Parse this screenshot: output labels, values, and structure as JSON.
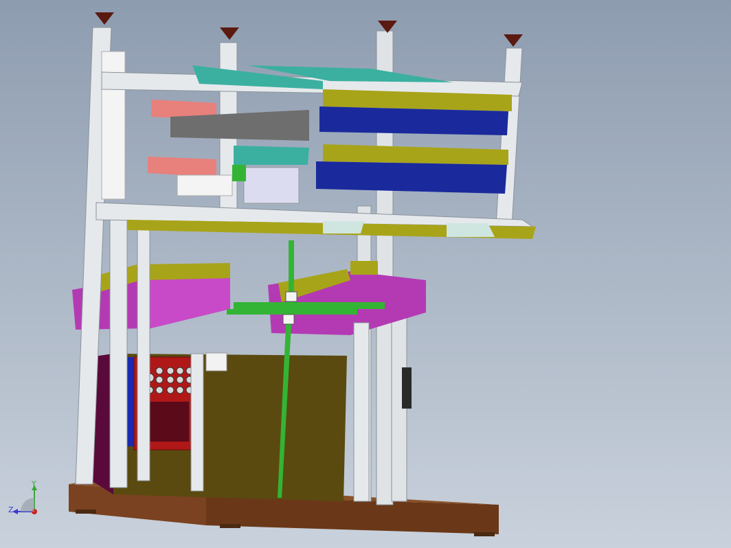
{
  "view": {
    "background_top": "#8e9cb0",
    "background_bottom": "#c9d1dc"
  },
  "triad": {
    "y_label": "Y",
    "z_label": "Z",
    "y_color": "#3aa63a",
    "z_color": "#3a3ad0",
    "x_color": "#d02020"
  },
  "colors": {
    "frame": "#dfe3e6",
    "frame_shadow": "#9aa3aa",
    "tray_olive": "#a8a419",
    "tray_blue": "#1a2a9c",
    "tray_teal": "#3cb0a0",
    "pink": "#e8807c",
    "dark_grey": "#6e6e6e",
    "magenta": "#b43ab4",
    "cylinder_green": "#34b434",
    "base_brown": "#6e3a18",
    "cabinet_olive": "#5a4a10",
    "panel_red": "#b01818",
    "panel_blue": "#1a2ab0",
    "maroon": "#5a0a3a",
    "foot": "#5a1a10"
  }
}
